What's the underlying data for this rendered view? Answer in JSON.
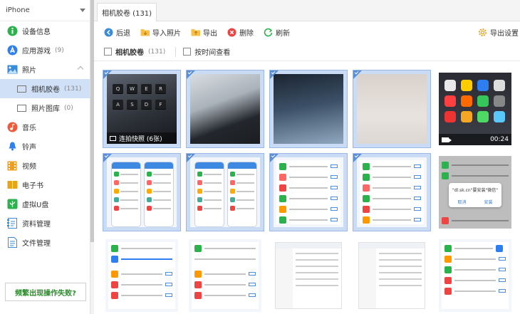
{
  "device": {
    "name": "iPhone"
  },
  "sidebar": {
    "items": [
      {
        "label": "设备信息",
        "icon": "info-icon",
        "color": "#2bb24c"
      },
      {
        "label": "应用游戏",
        "count": "(9)",
        "icon": "app-store-icon",
        "color": "#2f80ed"
      },
      {
        "label": "照片",
        "icon": "photo-icon",
        "color": "#3a8bd8"
      },
      {
        "label": "相机胶卷",
        "count": "(131)",
        "icon": "camera-roll-icon",
        "active": true
      },
      {
        "label": "照片图库",
        "count": "(0)",
        "icon": "photo-library-icon"
      },
      {
        "label": "音乐",
        "icon": "music-icon",
        "color": "#f05a3a"
      },
      {
        "label": "铃声",
        "icon": "bell-icon",
        "color": "#2f80ed"
      },
      {
        "label": "视频",
        "icon": "video-icon",
        "color": "#f0a020"
      },
      {
        "label": "电子书",
        "icon": "book-icon",
        "color": "#e8a317"
      },
      {
        "label": "虚拟U盘",
        "icon": "usb-icon",
        "color": "#2bb24c"
      },
      {
        "label": "资料管理",
        "icon": "contacts-icon",
        "color": "#3a8bd8"
      },
      {
        "label": "文件管理",
        "icon": "file-icon",
        "color": "#3a8bd8"
      }
    ],
    "fail_link": "频繁出现操作失败?"
  },
  "tab": {
    "title": "相机胶卷 (131)"
  },
  "toolbar": {
    "back": "后退",
    "import": "导入照片",
    "export": "导出",
    "delete": "删除",
    "refresh": "刷新",
    "export_settings": "导出设置"
  },
  "filter": {
    "album_label": "相机胶卷",
    "album_count": "(131)",
    "by_time": "按时间查看"
  },
  "thumbs": {
    "burst_label": "连拍快照 (6张)",
    "video_duration": "00:24",
    "keys_row1": [
      "Q",
      "W",
      "E",
      "R"
    ],
    "keys_row2": [
      "A",
      "S",
      "D",
      "F"
    ],
    "dialog_text": "\"dl.sk.cn\"要安装\"微信\"",
    "dialog_cancel": "取消",
    "dialog_install": "安装"
  },
  "colors": {
    "accent": "#5a8fd8",
    "selected_bg": "#cadcf5",
    "fail_text": "#2a8a2a"
  }
}
